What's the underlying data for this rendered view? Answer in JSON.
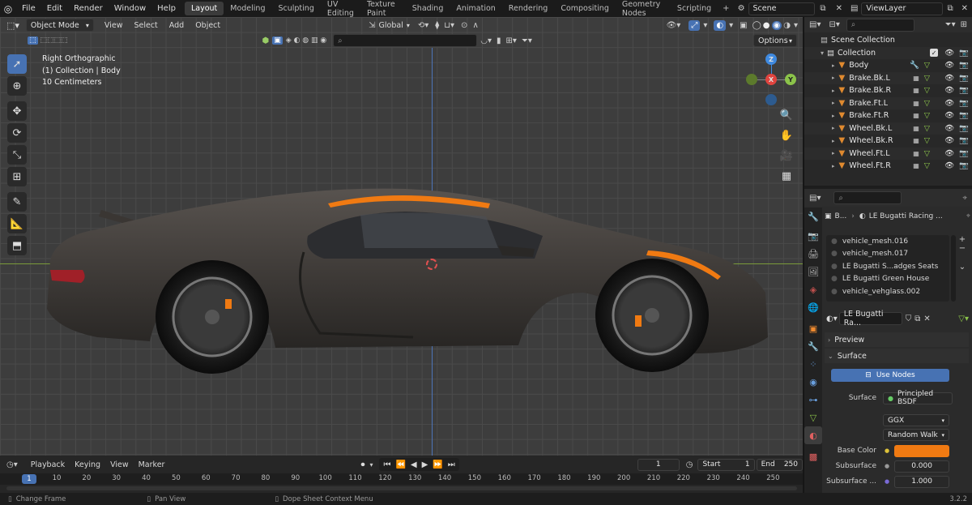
{
  "topbar": {
    "menus": [
      "File",
      "Edit",
      "Render",
      "Window",
      "Help"
    ],
    "workspaces": [
      "Layout",
      "Modeling",
      "Sculpting",
      "UV Editing",
      "Texture Paint",
      "Shading",
      "Animation",
      "Rendering",
      "Compositing",
      "Geometry Nodes",
      "Scripting"
    ],
    "active_workspace": "Layout",
    "scene": "Scene",
    "view_layer": "ViewLayer"
  },
  "viewport_header": {
    "mode": "Object Mode",
    "menus": [
      "View",
      "Select",
      "Add",
      "Object"
    ],
    "transform_orientation": "Global",
    "options_label": "Options"
  },
  "viewport_overlay": {
    "view_name": "Right Orthographic",
    "collection_line": "(1) Collection | Body",
    "scale_line": "10 Centimeters"
  },
  "gizmo": {
    "z": "Z",
    "x": "X",
    "y": "Y"
  },
  "outliner": {
    "root": "Scene Collection",
    "collection": "Collection",
    "items": [
      "Body",
      "Brake.Bk.L",
      "Brake.Bk.R",
      "Brake.Ft.L",
      "Brake.Ft.R",
      "Wheel.Bk.L",
      "Wheel.Bk.R",
      "Wheel.Ft.L",
      "Wheel.Ft.R"
    ]
  },
  "properties": {
    "breadcrumb_obj": "B...",
    "breadcrumb_mat": "LE Bugatti Racing ...",
    "material_slots": [
      "vehicle_mesh.016",
      "vehicle_mesh.017",
      "LE Bugatti S...adges Seats",
      "LE Bugatti Green House",
      "vehicle_vehglass.002"
    ],
    "material_name": "LE Bugatti Ra...",
    "preview_label": "Preview",
    "surface_label": "Surface",
    "use_nodes_label": "Use Nodes",
    "surface_field_label": "Surface",
    "surface_value": "Principled BSDF",
    "distribution": "GGX",
    "subsurface_method": "Random Walk",
    "base_color_label": "Base Color",
    "base_color": "#f07a12",
    "subsurface_label": "Subsurface",
    "subsurface_value": "0.000",
    "subsurface_radius_label": "Subsurface ...",
    "subsurface_radius_value": "1.000"
  },
  "timeline": {
    "menus": [
      "Playback",
      "Keying",
      "View",
      "Marker"
    ],
    "current_frame": "1",
    "start_label": "Start",
    "start_value": "1",
    "end_label": "End",
    "end_value": "250",
    "ruler_current": "1",
    "ruler_ticks": [
      "10",
      "20",
      "30",
      "40",
      "50",
      "60",
      "70",
      "80",
      "90",
      "100",
      "110",
      "120",
      "130",
      "140",
      "150",
      "160",
      "170",
      "180",
      "190",
      "200",
      "210",
      "220",
      "230",
      "240",
      "250"
    ]
  },
  "statusbar": {
    "change_frame": "Change Frame",
    "pan_view": "Pan View",
    "context_menu": "Dope Sheet Context Menu",
    "version": "3.2.2"
  },
  "colors": {
    "accent": "#4772b3",
    "orange": "#f07a12",
    "gizmo_x": "#e0443f",
    "gizmo_y": "#8bc34a",
    "gizmo_z": "#3f8ae0"
  }
}
